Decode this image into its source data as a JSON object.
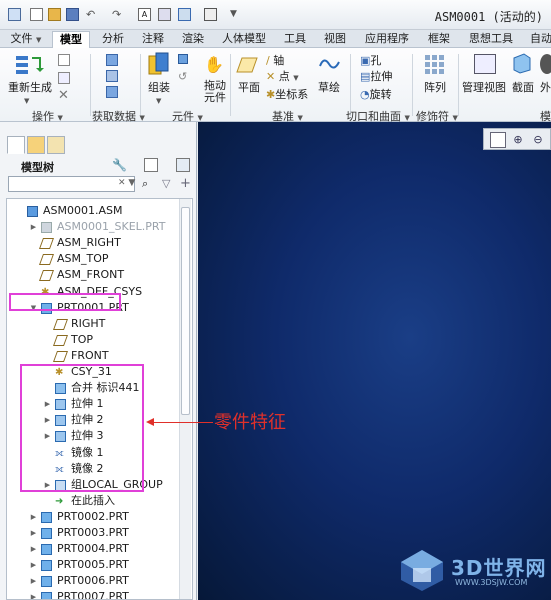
{
  "window": {
    "title": "ASM0001 (活动的)"
  },
  "menu_tabs": [
    "文件",
    "模型",
    "分析",
    "注释",
    "渲染",
    "人体模型",
    "工具",
    "视图",
    "应用程序",
    "框架",
    "思想工具",
    "自动"
  ],
  "ribbon": {
    "regenerate": "重新生成",
    "assemble": "组装",
    "drag_components": "拖动\n元件",
    "plane": "平面",
    "axis": "轴",
    "point": "点",
    "csys": "坐标系",
    "sketch": "草绘",
    "hole": "孔",
    "extrude": "拉伸",
    "revolve": "旋转",
    "pattern": "阵列",
    "manage_views": "管理视图",
    "section": "截面",
    "appearance": "外",
    "groups": [
      "操作",
      "获取数据",
      "元件",
      "基准",
      "切口和曲面",
      "修饰符",
      "模"
    ]
  },
  "model_tree": {
    "title": "模型树",
    "search_placeholder": "",
    "items": [
      {
        "label": "ASM0001.ASM",
        "icon": "assembly-icon",
        "level": 0,
        "expander": ""
      },
      {
        "label": "ASM0001_SKEL.PRT",
        "icon": "skeleton-icon",
        "level": 1,
        "expander": "▶",
        "muted": true
      },
      {
        "label": "ASM_RIGHT",
        "icon": "datum-plane-icon",
        "level": 1,
        "expander": ""
      },
      {
        "label": "ASM_TOP",
        "icon": "datum-plane-icon",
        "level": 1,
        "expander": ""
      },
      {
        "label": "ASM_FRONT",
        "icon": "datum-plane-icon",
        "level": 1,
        "expander": ""
      },
      {
        "label": "ASM_DEF_CSYS",
        "icon": "csys-icon",
        "level": 1,
        "expander": ""
      },
      {
        "label": "PRT0001.PRT",
        "icon": "part-icon",
        "level": 1,
        "expander": "▼"
      },
      {
        "label": "RIGHT",
        "icon": "datum-plane-icon",
        "level": 2,
        "expander": ""
      },
      {
        "label": "TOP",
        "icon": "datum-plane-icon",
        "level": 2,
        "expander": ""
      },
      {
        "label": "FRONT",
        "icon": "datum-plane-icon",
        "level": 2,
        "expander": ""
      },
      {
        "label": "CSY_31",
        "icon": "csys-icon",
        "level": 2,
        "expander": ""
      },
      {
        "label": "合并 标识441",
        "icon": "merge-icon",
        "level": 2,
        "expander": ""
      },
      {
        "label": "拉伸 1",
        "icon": "extrude-icon",
        "level": 2,
        "expander": "▶"
      },
      {
        "label": "拉伸 2",
        "icon": "extrude-icon",
        "level": 2,
        "expander": "▶"
      },
      {
        "label": "拉伸 3",
        "icon": "extrude-icon",
        "level": 2,
        "expander": "▶"
      },
      {
        "label": "镜像 1",
        "icon": "mirror-icon",
        "level": 2,
        "expander": ""
      },
      {
        "label": "镜像 2",
        "icon": "mirror-icon",
        "level": 2,
        "expander": ""
      },
      {
        "label": "组LOCAL_GROUP",
        "icon": "group-icon",
        "level": 2,
        "expander": "▶"
      },
      {
        "label": "在此插入",
        "icon": "insert-here-icon",
        "level": 2,
        "expander": ""
      },
      {
        "label": "PRT0002.PRT",
        "icon": "part-icon",
        "level": 1,
        "expander": "▶"
      },
      {
        "label": "PRT0003.PRT",
        "icon": "part-icon",
        "level": 1,
        "expander": "▶"
      },
      {
        "label": "PRT0004.PRT",
        "icon": "part-icon",
        "level": 1,
        "expander": "▶"
      },
      {
        "label": "PRT0005.PRT",
        "icon": "part-icon",
        "level": 1,
        "expander": "▶"
      },
      {
        "label": "PRT0006.PRT",
        "icon": "part-icon",
        "level": 1,
        "expander": "▶"
      },
      {
        "label": "PRT0007.PRT",
        "icon": "part-icon",
        "level": 1,
        "expander": "▶"
      }
    ]
  },
  "annotation": {
    "text": "零件特征"
  },
  "watermark": {
    "text": "3D世界网",
    "url": "WWW.3DSJW.COM"
  },
  "colors": {
    "highlight": "#e040d8",
    "annotation": "#e0302a",
    "viewport": "#0f2a6a"
  }
}
